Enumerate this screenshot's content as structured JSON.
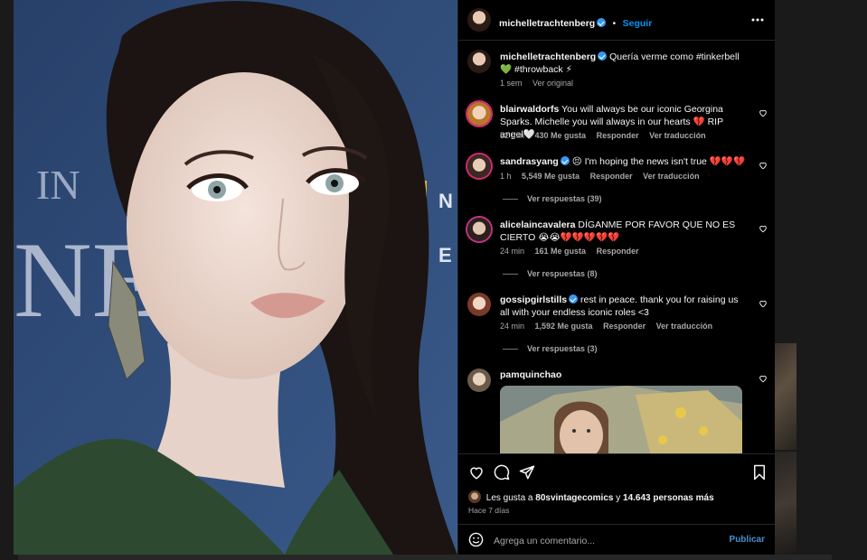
{
  "header": {
    "username": "michelletrachtenberg",
    "separator": "•",
    "follow_label": "Seguir",
    "more_icon": "ellipsis-icon"
  },
  "caption": {
    "username": "michelletrachtenberg",
    "text": "Quería verme como #tinkerbell 💚 #throwback ⚡",
    "time": "1 sem",
    "see_original": "Ver original"
  },
  "comments": [
    {
      "username": "blairwaldorfs",
      "text": "You will always be our iconic Georgina Sparks. Michelle you will always in our hearts 💔 RIP angel🤍",
      "time": "52 min",
      "likes": "430 Me gusta",
      "reply": "Responder",
      "translate": "Ver traducción",
      "replies": ""
    },
    {
      "username": "sandrasyang",
      "text": "😣 I'm hoping the news isn't true 💔💔💔",
      "time": "1 h",
      "likes": "5,549 Me gusta",
      "reply": "Responder",
      "translate": "Ver traducción",
      "replies": "Ver respuestas (39)"
    },
    {
      "username": "alicelaincavalera",
      "text": "DÍGANME POR FAVOR QUE NO ES CIERTO 😭😭💔💔💔💔💔",
      "time": "24 min",
      "likes": "161 Me gusta",
      "reply": "Responder",
      "translate": "",
      "replies": "Ver respuestas (8)"
    },
    {
      "username": "gossipgirlstills",
      "text": "rest in peace. thank you for raising us all with your endless iconic roles <3",
      "time": "24 min",
      "likes": "1,592 Me gusta",
      "reply": "Responder",
      "translate": "Ver traducción",
      "replies": "Ver respuestas (3)"
    },
    {
      "username": "pamquinchao",
      "text": "",
      "time": "",
      "likes": "",
      "reply": "",
      "translate": "",
      "replies": ""
    }
  ],
  "actions": {
    "liked_by_prefix": "Les gusta a",
    "liked_by_user": "80svintagecomics",
    "liked_by_middle": "y",
    "liked_by_count": "14.643 personas más",
    "date": "Hace 7 días"
  },
  "add_comment": {
    "placeholder": "Agrega un comentario...",
    "publish_label": "Publicar"
  },
  "colors": {
    "accent": "#0095f6",
    "verified": "#3897f0",
    "muted": "#a8a8a8",
    "panel_bg": "#000000"
  }
}
